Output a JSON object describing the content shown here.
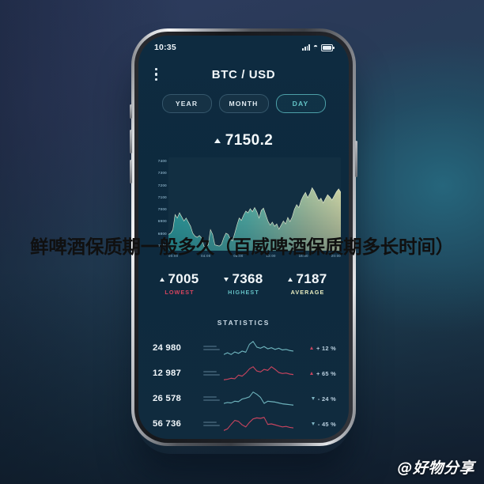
{
  "background": {
    "top_color": "#2e3c60",
    "bottom_color": "#18283c",
    "glow_color": "#26687e"
  },
  "overlay": {
    "caption": "鲜啤酒保质期一般多久（百威啤酒保质期多长时间）",
    "watermark": "@好物分享"
  },
  "phone": {
    "status_bar": {
      "time": "10:35",
      "signal_icon": "signal-bars-icon",
      "wifi_icon": "wifi-icon",
      "battery_icon": "battery-full-icon"
    },
    "header": {
      "menu_icon": "kebab-menu-icon",
      "title": "BTC / USD"
    },
    "periods": [
      {
        "label": "YEAR",
        "active": false
      },
      {
        "label": "MONTH",
        "active": false
      },
      {
        "label": "DAY",
        "active": true
      }
    ],
    "price": {
      "direction_icon": "triangle-up-icon",
      "value": "7150.2"
    },
    "summary": [
      {
        "value": "7005",
        "label": "LOWEST",
        "direction": "up",
        "color": "#d8445f"
      },
      {
        "value": "7368",
        "label": "HIGHEST",
        "direction": "down",
        "color": "#63bfc4"
      },
      {
        "value": "7187",
        "label": "AVERAGE",
        "direction": "up",
        "color": "#e8edc0"
      }
    ],
    "statistics": {
      "title": "STATISTICS",
      "rows": [
        {
          "value": "24 980",
          "change": "+ 12 %",
          "direction": "up",
          "spark_color": "#6fb4bd"
        },
        {
          "value": "12 987",
          "change": "+ 65 %",
          "direction": "up",
          "spark_color": "#c8445e"
        },
        {
          "value": "26 578",
          "change": "- 24 %",
          "direction": "down",
          "spark_color": "#6fb4bd"
        },
        {
          "value": "56 736",
          "change": "- 45 %",
          "direction": "down",
          "spark_color": "#c8445e"
        }
      ]
    }
  },
  "chart_data": {
    "type": "area",
    "title": "BTC / USD",
    "xlabel": "",
    "ylabel": "",
    "ylim": [
      6650,
      7450
    ],
    "yticks": [
      7400,
      7300,
      7200,
      7100,
      7000,
      6900,
      6800,
      6700
    ],
    "xticks": [
      "00:00",
      "04:00",
      "08:00",
      "12:00",
      "16:00",
      "20:00"
    ],
    "grid": false,
    "legend": "none",
    "gradient": {
      "from": "#3fb7b5",
      "to": "#eaefb8"
    },
    "series": [
      {
        "name": "BTC / USD",
        "values": [
          6790,
          6800,
          6830,
          6960,
          6930,
          6975,
          6940,
          6905,
          6930,
          6895,
          6860,
          6800,
          6775,
          6765,
          6780,
          6760,
          6690,
          6685,
          6700,
          6830,
          6790,
          6700,
          6695,
          6690,
          6705,
          6760,
          6800,
          6790,
          6750,
          6735,
          6800,
          6870,
          6930,
          6910,
          6955,
          6990,
          6975,
          7010,
          6985,
          7020,
          6985,
          6930,
          6995,
          7015,
          6960,
          6905,
          6870,
          6895,
          6860,
          6880,
          6835,
          6870,
          6905,
          6880,
          6935,
          6900,
          6940,
          7005,
          7045,
          7020,
          7080,
          7120,
          7150,
          7105,
          7140,
          7190,
          7160,
          7120,
          7080,
          7100,
          7060,
          7095,
          7130,
          7110,
          7085,
          7120,
          7155,
          7180,
          7150
        ]
      }
    ],
    "sparklines": [
      {
        "name": "24 980",
        "values": [
          40,
          46,
          40,
          49,
          44,
          52,
          48,
          76,
          86,
          66,
          62,
          68,
          60,
          64,
          58,
          62,
          56,
          58,
          54,
          52
        ]
      },
      {
        "name": "12 987",
        "values": [
          16,
          18,
          22,
          20,
          34,
          30,
          42,
          58,
          66,
          50,
          46,
          56,
          52,
          66,
          56,
          44,
          40,
          42,
          38,
          36
        ]
      },
      {
        "name": "26 578",
        "values": [
          34,
          38,
          36,
          44,
          42,
          54,
          58,
          64,
          86,
          76,
          62,
          34,
          44,
          42,
          40,
          36,
          32,
          30,
          28,
          26
        ]
      },
      {
        "name": "56 736",
        "values": [
          16,
          22,
          40,
          56,
          52,
          38,
          30,
          48,
          62,
          66,
          64,
          68,
          40,
          42,
          38,
          34,
          30,
          32,
          28,
          26
        ]
      }
    ]
  }
}
